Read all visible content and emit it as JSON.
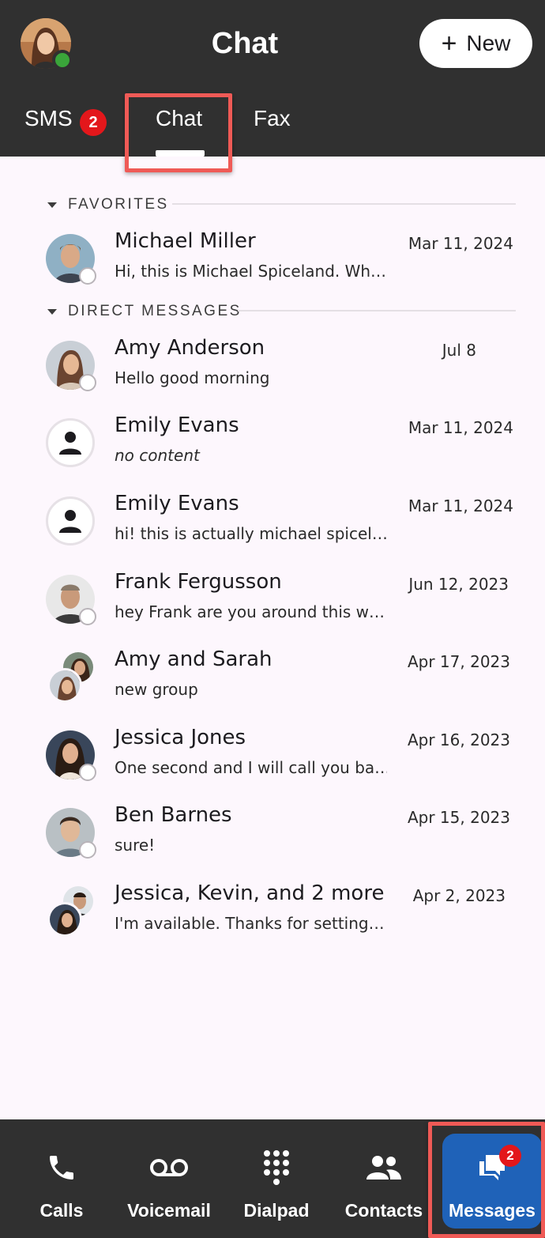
{
  "header": {
    "title": "Chat",
    "new_button": {
      "label": "New",
      "icon": "plus-icon"
    },
    "profile": {
      "presence_color": "#3aa53a"
    }
  },
  "tabs": [
    {
      "label": "SMS",
      "badge": "2"
    },
    {
      "label": "Chat",
      "selected": true
    },
    {
      "label": "Fax"
    }
  ],
  "sections": {
    "favorites": {
      "label": "FAVORITES",
      "items": [
        {
          "name": "Michael Miller",
          "preview": "Hi, this is Michael Spiceland.  Wh…",
          "date": "Mar 11, 2024"
        }
      ]
    },
    "direct": {
      "label": "DIRECT MESSAGES",
      "items": [
        {
          "name": "Amy Anderson",
          "preview": "Hello good morning",
          "date": "Jul 8"
        },
        {
          "name": "Emily Evans",
          "preview": "no content",
          "date": "Mar 11, 2024"
        },
        {
          "name": "Emily Evans",
          "preview": "hi!  this is actually michael spicel…",
          "date": "Mar 11, 2024"
        },
        {
          "name": "Frank Fergusson",
          "preview": "hey Frank are you around this w…",
          "date": "Jun 12, 2023"
        },
        {
          "name": "Amy and Sarah",
          "preview": "new group",
          "date": "Apr 17, 2023"
        },
        {
          "name": "Jessica Jones",
          "preview": "One second and I will call you ba…",
          "date": "Apr 16, 2023"
        },
        {
          "name": "Ben Barnes",
          "preview": "sure!",
          "date": "Apr 15, 2023"
        },
        {
          "name": "Jessica, Kevin, and 2 more",
          "preview": "I'm available.  Thanks for setting…",
          "date": "Apr 2, 2023"
        }
      ]
    }
  },
  "bottom_nav": [
    {
      "label": "Calls",
      "icon": "phone-icon"
    },
    {
      "label": "Voicemail",
      "icon": "voicemail-icon"
    },
    {
      "label": "Dialpad",
      "icon": "dialpad-icon"
    },
    {
      "label": "Contacts",
      "icon": "contacts-icon"
    },
    {
      "label": "Messages",
      "icon": "messages-icon",
      "badge": "2",
      "selected": true
    }
  ],
  "colors": {
    "header_bg": "#303030",
    "list_bg": "#fdf7fd",
    "badge": "#e3171b",
    "selected_nav": "#1f62b8",
    "highlight_outline": "#ef5a56"
  }
}
